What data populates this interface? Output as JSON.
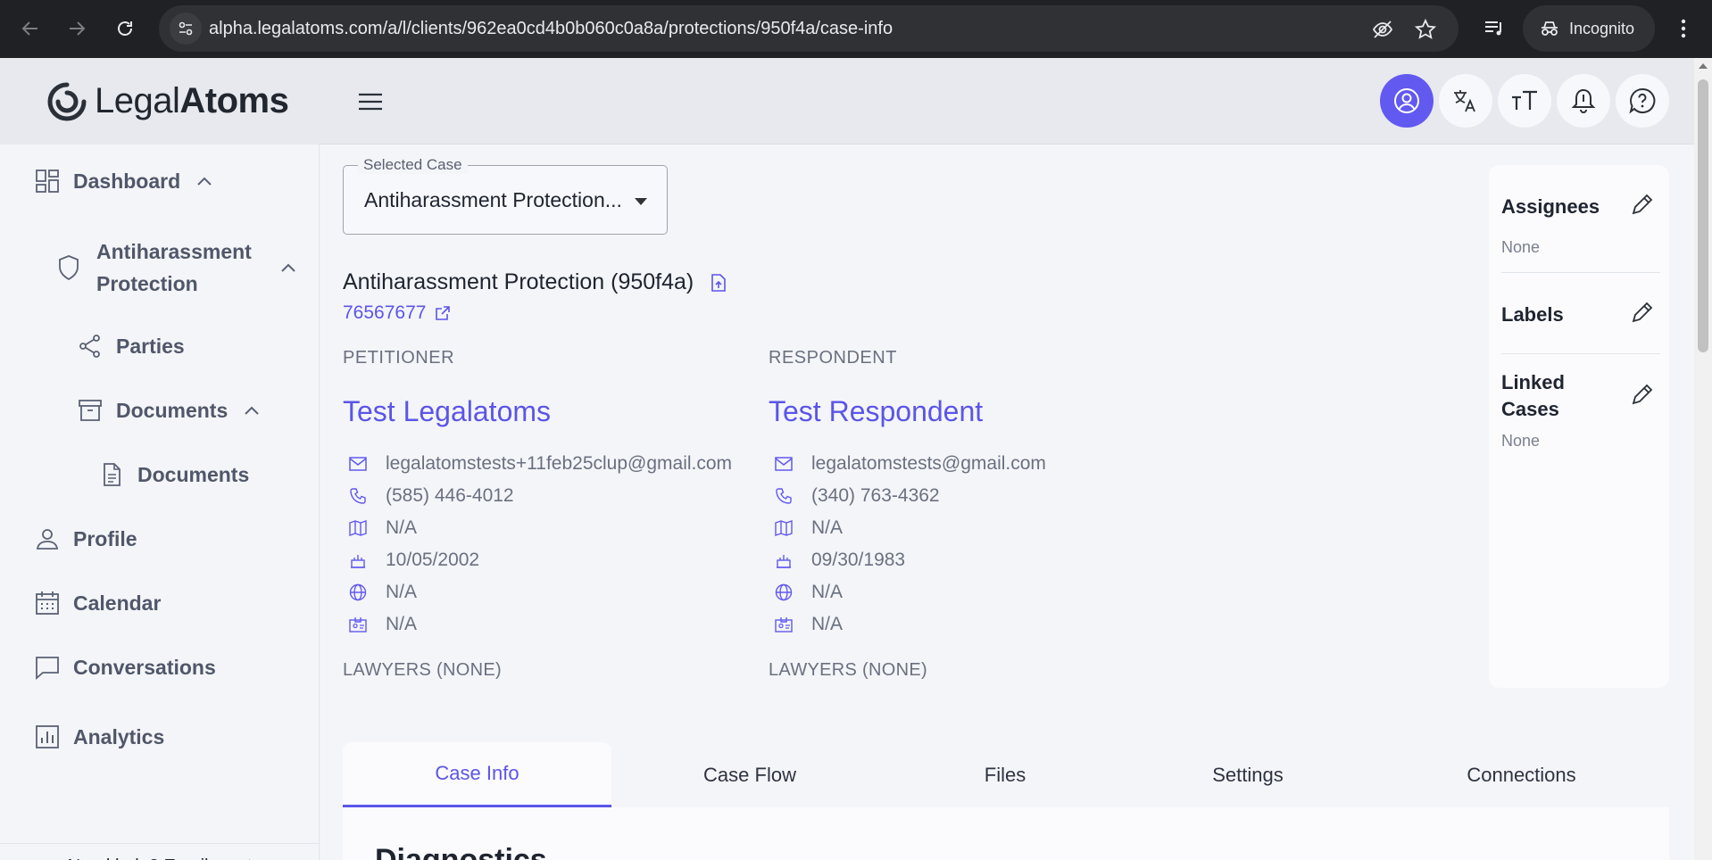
{
  "browser": {
    "url_host": "alpha.legalatoms.com",
    "url_path": "/a/l/clients/962ea0cd4b0b060c0a8a/protections/950f4a/case-info",
    "incognito_label": "Incognito"
  },
  "brand": {
    "name_light": "Legal",
    "name_bold": "Atoms"
  },
  "sidebar": {
    "items": [
      {
        "label": "Dashboard",
        "icon": "grid-icon"
      },
      {
        "label": "Antiharassment",
        "label2": "Protection",
        "icon": "shield-icon"
      },
      {
        "label": "Parties",
        "icon": "share-icon"
      },
      {
        "label": "Documents",
        "icon": "archive-icon"
      },
      {
        "label": "Documents",
        "icon": "file-icon"
      },
      {
        "label": "Profile",
        "icon": "user-icon"
      },
      {
        "label": "Calendar",
        "icon": "calendar-icon"
      },
      {
        "label": "Conversations",
        "icon": "chat-icon"
      },
      {
        "label": "Analytics",
        "icon": "chart-icon"
      }
    ],
    "help_text": "Need help? Email us at"
  },
  "main": {
    "selected_case_label": "Selected Case",
    "selected_case_value": "Antiharassment Protection...",
    "case_title": "Antiharassment Protection (950f4a)",
    "case_number": "76567677",
    "petitioner": {
      "role": "PETITIONER",
      "name": "Test Legalatoms",
      "email": "legalatomstests+11feb25clup@gmail.com",
      "phone": "(585) 446-4012",
      "address": "N/A",
      "birthday": "10/05/2002",
      "language": "N/A",
      "id": "N/A",
      "lawyers": "LAWYERS (NONE)"
    },
    "respondent": {
      "role": "RESPONDENT",
      "name": "Test Respondent",
      "email": "legalatomstests@gmail.com",
      "phone": "(340) 763-4362",
      "address": "N/A",
      "birthday": "09/30/1983",
      "language": "N/A",
      "id": "N/A",
      "lawyers": "LAWYERS (NONE)"
    },
    "right_panel": {
      "assignees_label": "Assignees",
      "assignees_value": "None",
      "labels_label": "Labels",
      "linked_cases_label_1": "Linked",
      "linked_cases_label_2": "Cases",
      "linked_cases_value": "None"
    },
    "tabs": [
      "Case Info",
      "Case Flow",
      "Files",
      "Settings",
      "Connections"
    ],
    "section_heading": "Diagnostics"
  },
  "colors": {
    "accent": "#5b55e8",
    "primary_button": "#6159f0"
  }
}
